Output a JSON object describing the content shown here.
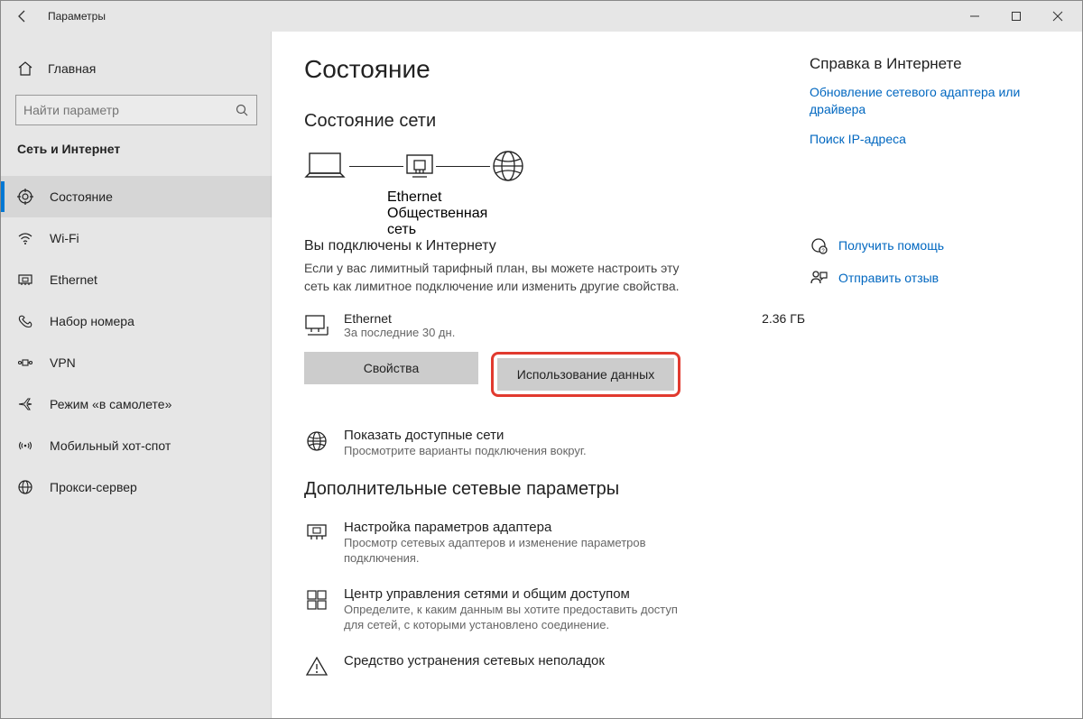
{
  "window": {
    "title": "Параметры"
  },
  "sidebar": {
    "home": "Главная",
    "search_placeholder": "Найти параметр",
    "category": "Сеть и Интернет",
    "items": [
      {
        "label": "Состояние",
        "active": true
      },
      {
        "label": "Wi-Fi"
      },
      {
        "label": "Ethernet"
      },
      {
        "label": "Набор номера"
      },
      {
        "label": "VPN"
      },
      {
        "label": "Режим «в самолете»"
      },
      {
        "label": "Мобильный хот-спот"
      },
      {
        "label": "Прокси-сервер"
      }
    ]
  },
  "page": {
    "title": "Состояние",
    "section1": "Состояние сети",
    "diagram": {
      "conn": "Ethernet",
      "nettype": "Общественная сеть"
    },
    "connected_title": "Вы подключены к Интернету",
    "connected_desc": "Если у вас лимитный тарифный план, вы можете настроить эту сеть как лимитное подключение или изменить другие свойства.",
    "conn": {
      "name": "Ethernet",
      "period": "За последние 30 дн.",
      "usage": "2.36 ГБ"
    },
    "btn_props": "Свойства",
    "btn_usage": "Использование данных",
    "show_networks": {
      "title": "Показать доступные сети",
      "desc": "Просмотрите варианты подключения вокруг."
    },
    "section2": "Дополнительные сетевые параметры",
    "adapter": {
      "title": "Настройка параметров адаптера",
      "desc": "Просмотр сетевых адаптеров и изменение параметров подключения."
    },
    "sharing": {
      "title": "Центр управления сетями и общим доступом",
      "desc": "Определите, к каким данным вы хотите предоставить доступ для сетей, с которыми установлено соединение."
    },
    "troubleshoot": {
      "title": "Средство устранения сетевых неполадок"
    }
  },
  "aside": {
    "help_title": "Справка в Интернете",
    "link1": "Обновление сетевого адаптера или драйвера",
    "link2": "Поиск IP-адреса",
    "get_help": "Получить помощь",
    "feedback": "Отправить отзыв"
  }
}
